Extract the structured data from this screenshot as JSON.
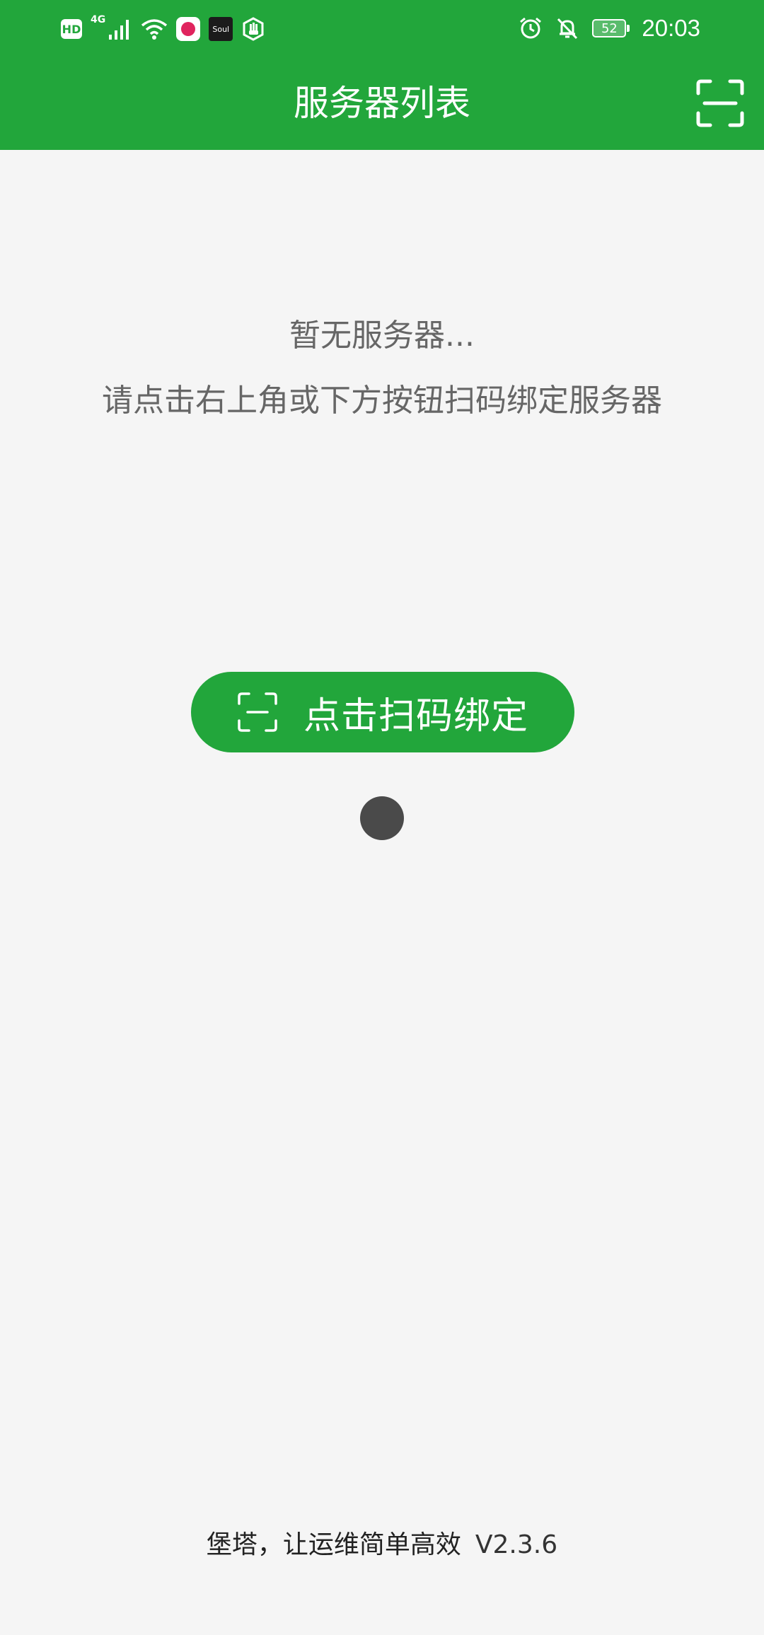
{
  "status_bar": {
    "hd_label": "HD",
    "network_label": "4G",
    "soul_label": "Soul",
    "battery_level": "52",
    "time": "20:03",
    "icons": [
      "hd-icon",
      "signal-icon",
      "wifi-icon",
      "app-icon",
      "soul-app-icon",
      "hand-icon",
      "alarm-icon",
      "bell-off-icon",
      "battery-icon"
    ]
  },
  "header": {
    "title": "服务器列表",
    "scan_icon": "scan-icon"
  },
  "empty_state": {
    "title": "暂无服务器...",
    "hint": "请点击右上角或下方按钮扫码绑定服务器"
  },
  "actions": {
    "scan_bind_label": "点击扫码绑定",
    "scan_bind_icon": "scan-icon"
  },
  "footer": {
    "slogan": "堡塔，让运维简单高效",
    "version": "V2.3.6"
  },
  "colors": {
    "brand": "#22a63b",
    "background": "#f5f5f5",
    "text_muted": "#666666"
  }
}
